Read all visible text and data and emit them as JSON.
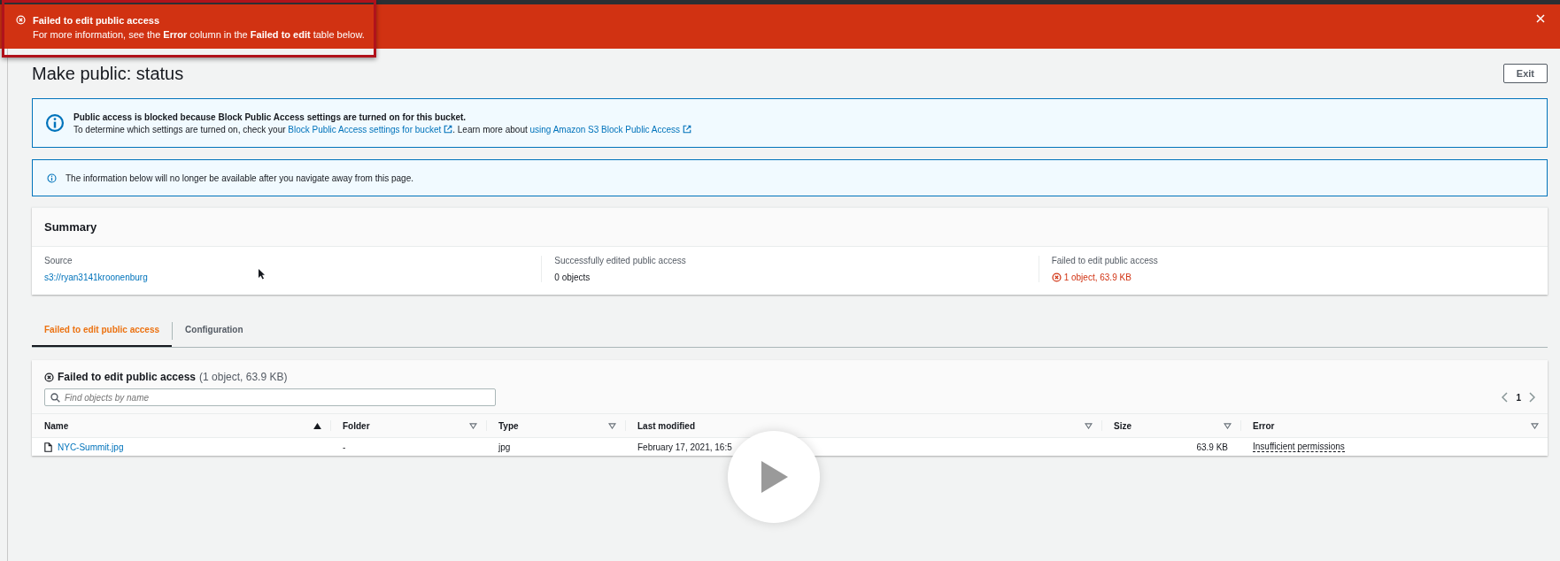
{
  "banner": {
    "title": "Failed to edit public access",
    "message": "For more information, see the **Error** column in the **Failed to edit** table below."
  },
  "page": {
    "title": "Make public: status",
    "exit_button": "Exit"
  },
  "alerts": [
    {
      "kind": "bordered",
      "title": "Public access is blocked because Block Public Access settings are turned on for this bucket.",
      "segments": [
        {
          "kind": "text",
          "text": "To determine which settings are turned on, check your "
        },
        {
          "kind": "link",
          "text": "Block Public Access settings for bucket"
        },
        {
          "kind": "text",
          "text": ". Learn more about "
        },
        {
          "kind": "link",
          "text": "using Amazon S3 Block Public Access"
        }
      ]
    },
    {
      "kind": "plain",
      "segments": [
        {
          "kind": "text",
          "text": "The information below will no longer be available after you navigate away from this page."
        }
      ]
    }
  ],
  "summary": {
    "title": "Summary",
    "columns": [
      {
        "label": "Source",
        "value": "s3://ryan3141kroonenburg",
        "kind": "link"
      },
      {
        "label": "Successfully edited public access",
        "value": "0 objects",
        "kind": "text"
      },
      {
        "label": "Failed to edit public access",
        "value": "1 object, 63.9 KB",
        "kind": "error"
      }
    ]
  },
  "tabs": [
    {
      "label": "Failed to edit public access",
      "selected": true
    },
    {
      "label": "Configuration",
      "selected": false
    }
  ],
  "table": {
    "title": "Failed to edit public access",
    "count": "(1 object, 63.9 KB)",
    "search": {
      "placeholder": "Find objects by name"
    },
    "page": "1",
    "columns": [
      {
        "label": "Name",
        "sorted": true,
        "kind": "name"
      },
      {
        "label": "Folder",
        "sorted": false,
        "kind": "text"
      },
      {
        "label": "Type",
        "sorted": false,
        "kind": "text"
      },
      {
        "label": "Last modified",
        "sorted": false,
        "kind": "text"
      },
      {
        "label": "Size",
        "sorted": false,
        "kind": "number"
      },
      {
        "label": "Error",
        "sorted": false,
        "kind": "error"
      }
    ],
    "rows": [
      {
        "cells": [
          "NYC-Summit.jpg",
          "-",
          "jpg",
          "February 17, 2021, 16:5",
          "63.9 KB",
          "Insufficient permissions"
        ]
      }
    ]
  }
}
